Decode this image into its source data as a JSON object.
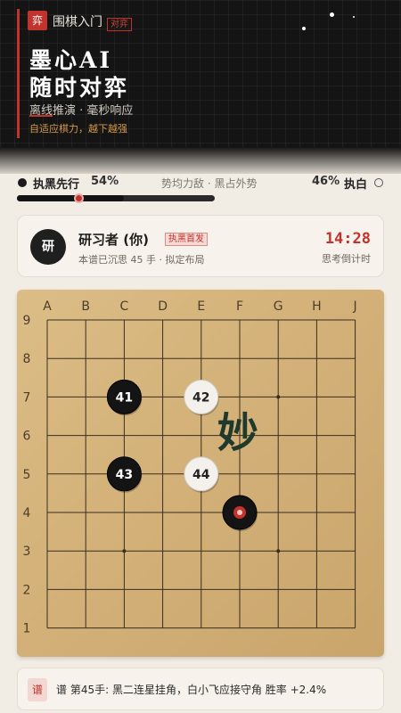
{
  "header": {
    "seal": "弈",
    "brand": "围棋入门",
    "tag": "对弈",
    "title_line1": "墨心AI",
    "title_line2": "随时对弈",
    "subtitle": "离线推演 · 毫秒响应",
    "slogan": "自适应棋力，越下越强"
  },
  "strength": {
    "left_label": "执黑先行",
    "left_percent": "54%",
    "center_text": "势均力敌 · 黑占外势",
    "right_percent": "46%",
    "right_label": "执白",
    "black_share": 0.54
  },
  "player": {
    "avatar": "研",
    "name": "研习者 (你)",
    "badge": "执黑首发",
    "detail": "本谱已沉思 45 手 · 拟定布局",
    "timer": "14:28",
    "timer_label": "思考倒计时"
  },
  "board": {
    "columns": [
      "A",
      "B",
      "C",
      "D",
      "E",
      "F",
      "G",
      "H",
      "J"
    ],
    "rows": [
      "9",
      "8",
      "7",
      "6",
      "5",
      "4",
      "3",
      "2",
      "1"
    ],
    "star_points": [
      [
        "C",
        "7"
      ],
      [
        "G",
        "7"
      ],
      [
        "C",
        "3"
      ],
      [
        "G",
        "3"
      ]
    ],
    "stones": [
      {
        "color": "black",
        "col": "C",
        "row": "7",
        "label": "41"
      },
      {
        "color": "white",
        "col": "E",
        "row": "7",
        "label": "42"
      },
      {
        "color": "black",
        "col": "C",
        "row": "5",
        "label": "43"
      },
      {
        "color": "white",
        "col": "E",
        "row": "5",
        "label": "44"
      },
      {
        "color": "black",
        "col": "F",
        "row": "4",
        "label": "",
        "last_move": true
      }
    ],
    "annotation": "妙"
  },
  "comment": {
    "tag": "谱",
    "text": "谱 第45手: 黑二连星挂角，白小飞应接守角  胜率 +2.4%"
  },
  "colors": {
    "accent": "#c2332b",
    "board": "#d4b27a",
    "gold": "#d49a4a",
    "annotation": "#1f3a2c"
  }
}
